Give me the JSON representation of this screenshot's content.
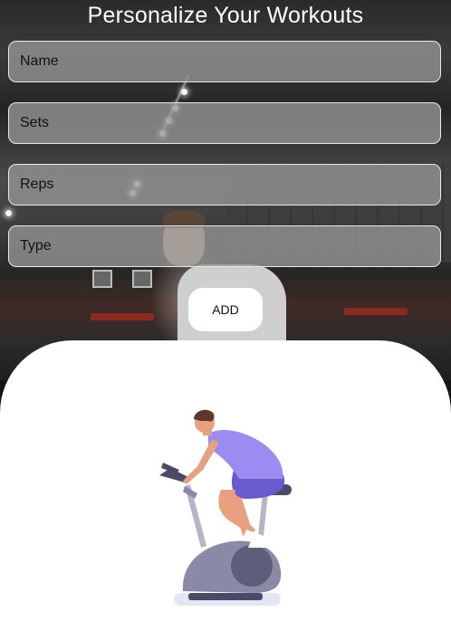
{
  "header": {
    "title": "Personalize Your Workouts"
  },
  "form": {
    "fields": [
      {
        "id": "name",
        "placeholder": "Name",
        "value": ""
      },
      {
        "id": "sets",
        "placeholder": "Sets",
        "value": ""
      },
      {
        "id": "reps",
        "placeholder": "Reps",
        "value": ""
      },
      {
        "id": "type",
        "placeholder": "Type",
        "value": ""
      }
    ],
    "add_label": "ADD"
  },
  "illustration": {
    "icon": "exercise-bike-illustration",
    "shirt_color": "#9b8cf2",
    "shorts_color": "#6a5ad0",
    "bike_color": "#8a8aa6"
  },
  "colors": {
    "field_fill": "#969696",
    "field_border": "#e8e8e8",
    "card": "#ffffff",
    "title": "#ffffff"
  }
}
